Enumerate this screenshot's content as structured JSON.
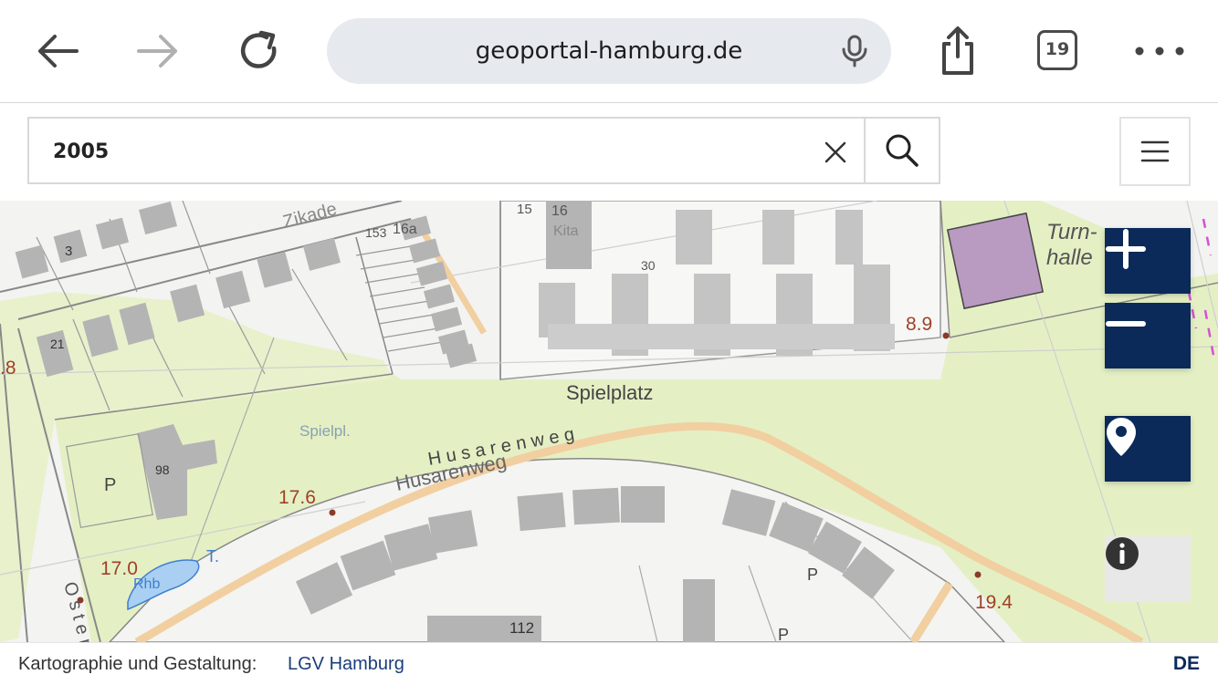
{
  "browser": {
    "url": "geoportal-hamburg.de",
    "tab_count": "19"
  },
  "search": {
    "value": "2005"
  },
  "map": {
    "labels": {
      "spielplatz": "Spielplatz",
      "spielpl": "Spielpl.",
      "husarenweg": "Husarenweg",
      "husarenweg_upper": "H u s a r e n w e g",
      "turnhalle_1": "Turn-",
      "turnhalle_2": "halle",
      "elev_89": "8.9",
      "elev_176": "17.6",
      "elev_170": "17.0",
      "elev_194": "19.4",
      "elev_8": ".8",
      "rhb": "Rhb",
      "t": "T.",
      "p1": "P",
      "p2": "P",
      "p3": "P",
      "kita": "Kita",
      "n15": "15",
      "n16": "16",
      "n30": "30",
      "n3": "3",
      "n112": "112",
      "n98": "98",
      "n21": "21",
      "n153": "153",
      "n16a": "16a",
      "str_upper": "Zikade",
      "oste": "O s t e r"
    },
    "colors": {
      "green": "#e4f0c4",
      "building": "#b4b4b4",
      "purple": "#b99ac1",
      "path": "#f2cfa0",
      "controls": "#0b2a5a"
    }
  },
  "footer": {
    "attribution_label": "Kartographie und Gestaltung:",
    "attribution_link": "LGV Hamburg",
    "language": "DE"
  }
}
